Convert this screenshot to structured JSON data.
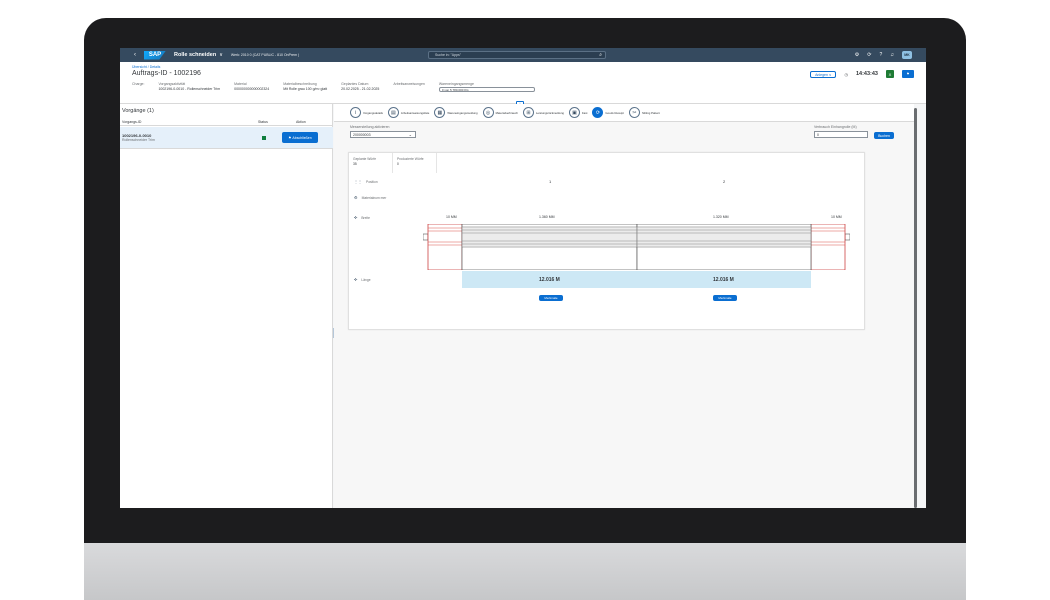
{
  "shell": {
    "back": "‹",
    "logo": "SAP",
    "app_title": "Rolle schneiden",
    "chev": "∨",
    "system": "Werk: 2010 0 (CAT PUBLIC - 810 OnPrem )",
    "search_placeholder": "Suche in: \"Apps\"",
    "avatar": "MK"
  },
  "header": {
    "breadcrumb": "Übersicht / Details",
    "title": "Auftrags-ID - 1002196",
    "create_button": "Anlegen",
    "time": "14:43:43",
    "attrs": [
      {
        "label": "Charge:",
        "value": ""
      },
      {
        "label": "Vorgangsaktivität",
        "value": "1002196-0-0010 - Rollenschneider Trim"
      },
      {
        "label": "Material",
        "value": "000000000000002324"
      },
      {
        "label": "Materialbeschreibung",
        "value": "Mit Rolle grau 100 g/m² glatt"
      },
      {
        "label": "Geplantes Datum",
        "value": "20.02.2025 - 21.02.2025"
      },
      {
        "label": "Arbeitsanweisungen",
        "value": ""
      },
      {
        "label": "Wareneingangsmenge",
        "value": "0 von 5 780.000 KG"
      }
    ]
  },
  "list": {
    "title": "Vorgänge (1)",
    "col_id": "Vorgangs-ID",
    "col_status": "Status",
    "col_action": "Aktion",
    "row": {
      "id": "1002196-0-0010",
      "sub": "Rollenschneider Trim",
      "button": "Abschließen"
    }
  },
  "steps": [
    {
      "icon": "i",
      "label": "Vorgangsdetails",
      "active": false
    },
    {
      "icon": "▤",
      "label": "Arbeitsanweisungsliste",
      "active": false
    },
    {
      "icon": "▦",
      "label": "Wareneingangsmeldung",
      "active": false
    },
    {
      "icon": "◎",
      "label": "Materialverbrauch",
      "active": false
    },
    {
      "icon": "⊞",
      "label": "Leistungsrückmeldung",
      "active": false
    },
    {
      "icon": "▣",
      "label": "Fast",
      "active": false
    },
    {
      "icon": "⟳",
      "label": "Goods Receipt",
      "active": true
    },
    {
      "icon": "✂",
      "label": "Slitting Pattern",
      "active": false
    }
  ],
  "controls": {
    "select_label": "Messerstellung aktivieren",
    "select_value": "200000003",
    "input_label": "Verbrauch Einhangrolle (M)",
    "input_value": "0",
    "book_button": "Buchen"
  },
  "card": {
    "kpi1_label": "Geplante Würfe",
    "kpi1_value": "35",
    "kpi2_label": "Produzierte Würfe",
    "kpi2_value": "0",
    "row_position": "Position",
    "row_material": "Materialnum mer",
    "row_width": "Breite",
    "row_length": "Länge",
    "pos1": "1",
    "pos2": "2",
    "w_left": "10 MM",
    "w1": "1.360 MM",
    "w2": "1.320 MM",
    "w_right": "10 MM",
    "len1": "12.016 M",
    "len2": "12.016 M",
    "char_button": "Merkmale"
  }
}
